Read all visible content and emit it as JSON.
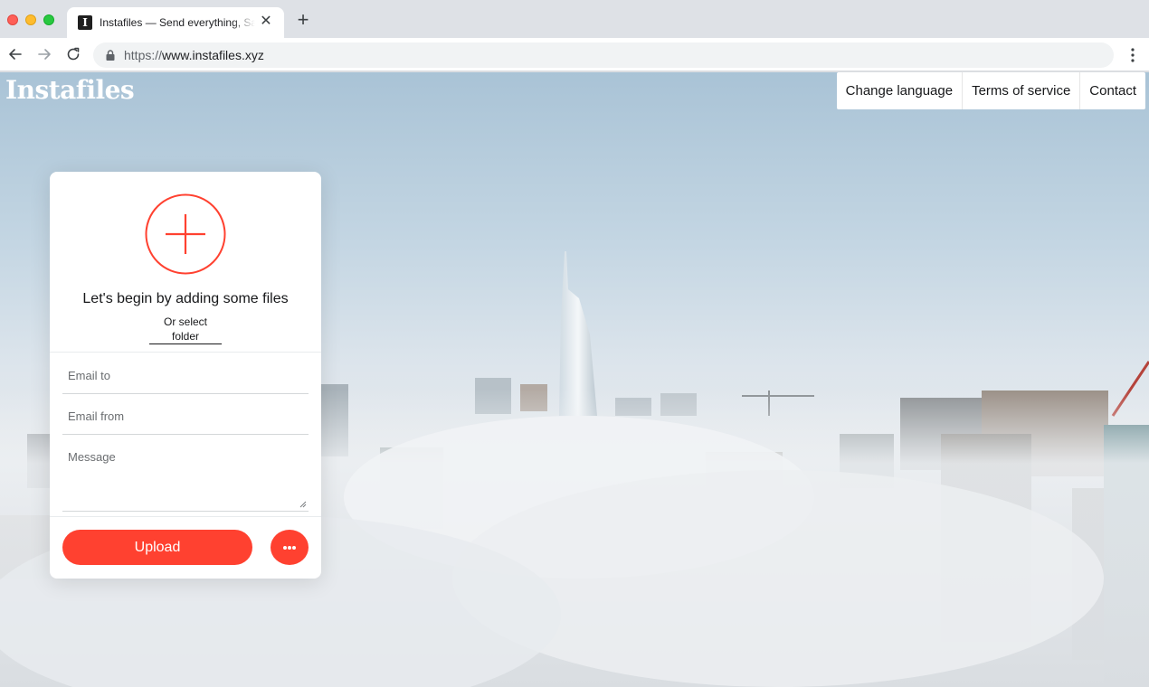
{
  "browser": {
    "tab_title": "Instafiles — Send everything, Safely",
    "tab_favicon": "I",
    "url_scheme": "https://",
    "url_host": "www.instafiles.xyz",
    "new_tab_icon": "plus-icon",
    "close_icon": "close-icon"
  },
  "site": {
    "logo": "Instafiles",
    "nav": [
      "Change language",
      "Terms of service",
      "Contact"
    ]
  },
  "uploader": {
    "title": "Let's begin by adding some files",
    "select_folder": "Or select folder",
    "email_to_placeholder": "Email to",
    "email_from_placeholder": "Email from",
    "message_placeholder": "Message",
    "upload_label": "Upload",
    "accent_color": "#ff4130"
  }
}
